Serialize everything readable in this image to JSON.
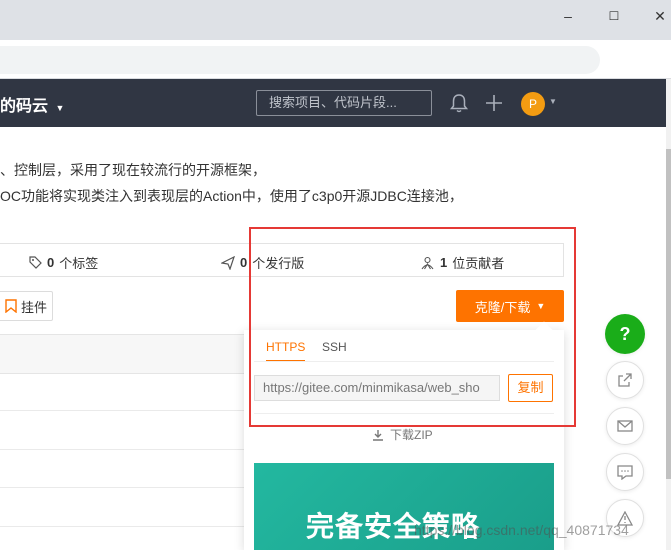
{
  "browser": {
    "minimize_label": "–",
    "maximize_label": "☐",
    "close_label": "✕"
  },
  "header": {
    "brand": "的码云",
    "search_placeholder": "搜索项目、代码片段...",
    "avatar_letter": "P"
  },
  "description": {
    "line1": "、控制层，采用了现在较流行的开源框架，",
    "line2": "OC功能将实现类注入到表现层的Action中，使用了c3p0开源JDBC连接池，"
  },
  "stats": {
    "tags_count": "0",
    "tags_label": "个标签",
    "releases_count": "0",
    "releases_label": "个发行版",
    "contributors_count": "1",
    "contributors_label": "位贡献者"
  },
  "widget_button": "挂件",
  "clone_button": "克隆/下载",
  "clone_panel": {
    "tab_https": "HTTPS",
    "tab_ssh": "SSH",
    "url": "https://gitee.com/minmikasa/web_sho",
    "copy_label": "复制",
    "download_zip": "下载ZIP",
    "banner_text": "完备安全策略"
  },
  "watermark": "https://blog.csdn.net/qq_40871734",
  "colors": {
    "accent": "#fe7300",
    "header_bg": "#303643",
    "help_green": "#1aad19",
    "highlight_red": "#e53935"
  }
}
